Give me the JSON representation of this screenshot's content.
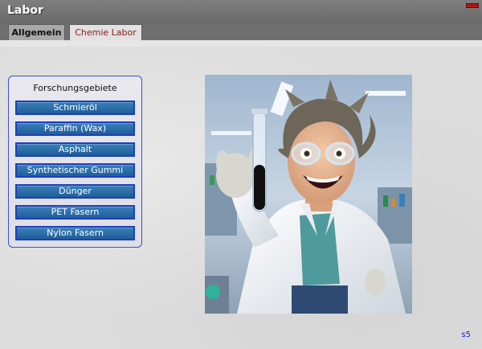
{
  "window": {
    "title": "Labor"
  },
  "tabs": [
    {
      "label": "Allgemein",
      "active": false
    },
    {
      "label": "Chemie Labor",
      "active": true
    }
  ],
  "research_panel": {
    "title": "Forschungsgebiete",
    "items": [
      {
        "label": "Schmieröl"
      },
      {
        "label": "Paraffin (Wax)"
      },
      {
        "label": "Asphalt"
      },
      {
        "label": "Synthetischer Gummi"
      },
      {
        "label": "Dünger"
      },
      {
        "label": "PET Fasern"
      },
      {
        "label": "Nylon Fasern"
      }
    ]
  },
  "footer": {
    "version": "s5"
  },
  "colors": {
    "button_fill": "#2a6aa8",
    "button_border": "#1d3fbf",
    "active_tab_text": "#8b1a1a",
    "panel_border": "#3a52c8"
  }
}
